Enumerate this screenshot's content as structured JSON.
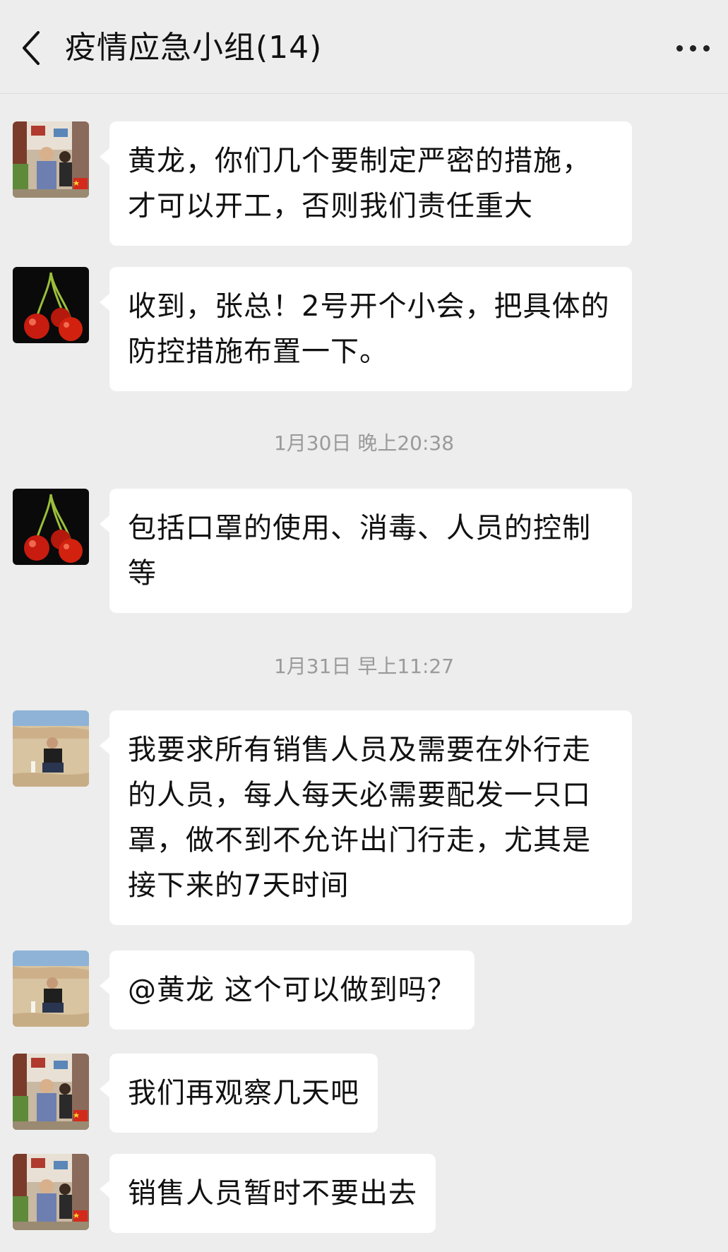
{
  "header": {
    "title": "疫情应急小组(14)",
    "back_icon": "chevron-left-icon",
    "more_icon": "more-dots-icon"
  },
  "messages": [
    {
      "avatar": "avatar-man-street",
      "text": "黄龙，你们几个要制定严密的措施，才可以开工，否则我们责任重大"
    },
    {
      "avatar": "avatar-cherries",
      "text": "收到，张总！2号开个小会，把具体的防控措施布置一下。"
    },
    {
      "avatar": "avatar-cherries",
      "text": "包括口罩的使用、消毒、人员的控制等"
    },
    {
      "avatar": "avatar-man-desert",
      "text": "我要求所有销售人员及需要在外行走的人员，每人每天必需要配发一只口罩，做不到不允许出门行走，尤其是接下来的7天时间"
    },
    {
      "avatar": "avatar-man-desert",
      "text": "@黄龙  这个可以做到吗？"
    },
    {
      "avatar": "avatar-man-street",
      "text": "我们再观察几天吧"
    },
    {
      "avatar": "avatar-man-street",
      "text": "销售人员暂时不要出去"
    }
  ],
  "timestamps": [
    "1月30日 晚上20:38",
    "1月31日 早上11:27"
  ],
  "colors": {
    "background": "#ededed",
    "bubble": "#ffffff",
    "timestamp_text": "#9a9a9a"
  }
}
